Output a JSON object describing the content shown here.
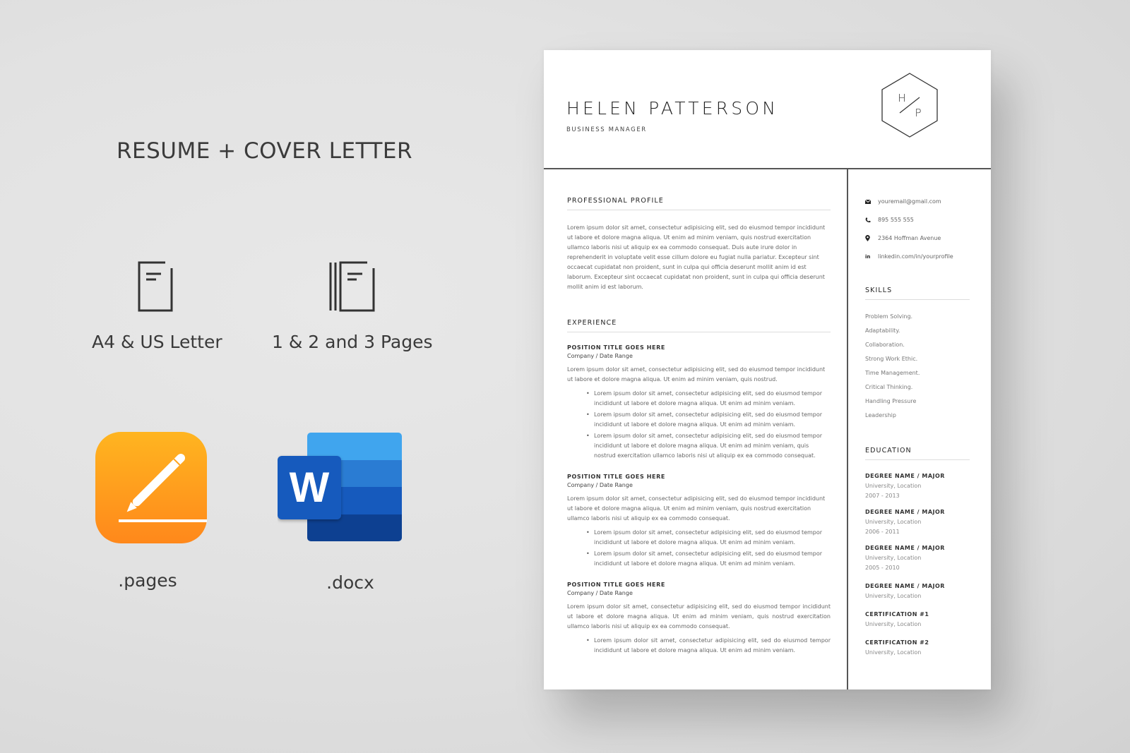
{
  "promo": {
    "title": "RESUME + COVER LETTER",
    "features": [
      {
        "icon": "document-icon",
        "label": "A4 & US Letter"
      },
      {
        "icon": "multi-page-document-icon",
        "label": "1 & 2 and 3 Pages"
      }
    ],
    "apps": [
      {
        "icon": "pages-app-icon",
        "label": ".pages",
        "colors": [
          "#ffb21f",
          "#ff8a1c"
        ]
      },
      {
        "icon": "word-app-icon",
        "label": ".docx",
        "letter": "W",
        "colors": [
          "#41a5ee",
          "#2b7cd3",
          "#185abd",
          "#103f91"
        ]
      }
    ]
  },
  "resume": {
    "name": "HELEN PATTERSON",
    "role": "BUSINESS MANAGER",
    "monogram": {
      "top": "H",
      "bottom": "P"
    },
    "profile": {
      "heading": "PROFESSIONAL PROFILE",
      "text": "Lorem ipsum dolor sit amet, consectetur adipisicing elit, sed do eiusmod tempor incididunt ut labore et dolore magna aliqua. Ut enim ad minim veniam, quis nostrud exercitation ullamco laboris nisi ut aliquip ex ea commodo consequat. Duis aute irure dolor in reprehenderit in voluptate velit esse cillum dolore eu fugiat nulla pariatur. Excepteur sint occaecat cupidatat non proident, sunt in culpa qui officia deserunt mollit anim id est laborum. Excepteur sint occaecat cupidatat non proident, sunt in culpa qui officia deserunt mollit anim id est laborum."
    },
    "experience": {
      "heading": "EXPERIENCE",
      "jobs": [
        {
          "title": "POSITION TITLE GOES HERE",
          "company": "Company / Date Range",
          "summary": "Lorem ipsum dolor sit amet, consectetur adipisicing elit, sed do eiusmod tempor incididunt ut labore et dolore magna aliqua. Ut enim ad minim veniam, quis nostrud.",
          "bullets": [
            "Lorem ipsum dolor sit amet, consectetur adipisicing elit, sed do eiusmod tempor incididunt ut labore et dolore magna aliqua. Ut enim ad minim veniam.",
            "Lorem ipsum dolor sit amet, consectetur adipisicing elit, sed do eiusmod tempor incididunt ut labore et dolore magna aliqua. Ut enim ad minim veniam.",
            "Lorem ipsum dolor sit amet, consectetur adipisicing elit, sed do eiusmod tempor incididunt ut labore et dolore magna aliqua. Ut enim ad minim veniam, quis nostrud exercitation ullamco laboris nisi ut aliquip ex ea commodo consequat."
          ]
        },
        {
          "title": "POSITION TITLE GOES HERE",
          "company": "Company / Date Range",
          "summary": "Lorem ipsum dolor sit amet, consectetur adipisicing elit, sed do eiusmod tempor incididunt ut labore et dolore magna aliqua. Ut enim ad minim veniam, quis nostrud exercitation ullamco laboris nisi ut aliquip ex ea commodo consequat.",
          "bullets": [
            "Lorem ipsum dolor sit amet, consectetur adipisicing elit, sed do eiusmod tempor incididunt ut labore et dolore magna aliqua. Ut enim ad minim veniam.",
            "Lorem ipsum dolor sit amet, consectetur adipisicing elit, sed do eiusmod tempor incididunt ut labore et dolore magna aliqua. Ut enim ad minim veniam."
          ]
        },
        {
          "title": "POSITION TITLE GOES HERE",
          "company": "Company / Date Range",
          "summary": "Lorem ipsum dolor sit amet, consectetur adipisicing elit, sed do eiusmod tempor incididunt ut labore et dolore magna aliqua. Ut enim ad minim veniam, quis nostrud exercitation ullamco laboris nisi ut aliquip ex ea commodo consequat.",
          "bullets": [
            "Lorem ipsum dolor sit amet, consectetur adipisicing elit, sed do eiusmod tempor incididunt ut labore et dolore magna aliqua. Ut enim ad minim veniam."
          ]
        }
      ]
    },
    "contact": [
      {
        "icon": "email-icon",
        "text": "youremail@gmail.com"
      },
      {
        "icon": "phone-icon",
        "text": "895 555 555"
      },
      {
        "icon": "location-pin-icon",
        "text": "2364 Hoffman Avenue"
      },
      {
        "icon": "linkedin-icon",
        "text": "linkedin.com/in/yourprofile"
      }
    ],
    "skills": {
      "heading": "SKILLS",
      "items": [
        "Problem Solving.",
        "Adaptability.",
        "Collaboration.",
        "Strong Work Ethic.",
        "Time Management.",
        "Critical Thinking.",
        "Handling Pressure",
        "Leadership"
      ]
    },
    "education": {
      "heading": "EDUCATION",
      "items": [
        {
          "title": "DEGREE NAME / MAJOR",
          "school": "University, Location",
          "years": "2007 - 2013"
        },
        {
          "title": "DEGREE NAME / MAJOR",
          "school": "University, Location",
          "years": "2006 - 2011"
        },
        {
          "title": "DEGREE NAME / MAJOR",
          "school": "University, Location",
          "years": "2005 - 2010"
        },
        {
          "title": "DEGREE NAME / MAJOR",
          "school": "University, Location"
        },
        {
          "title": "CERTIFICATION #1",
          "school": "University, Location"
        },
        {
          "title": "CERTIFICATION #2",
          "school": "University, Location"
        }
      ]
    }
  }
}
